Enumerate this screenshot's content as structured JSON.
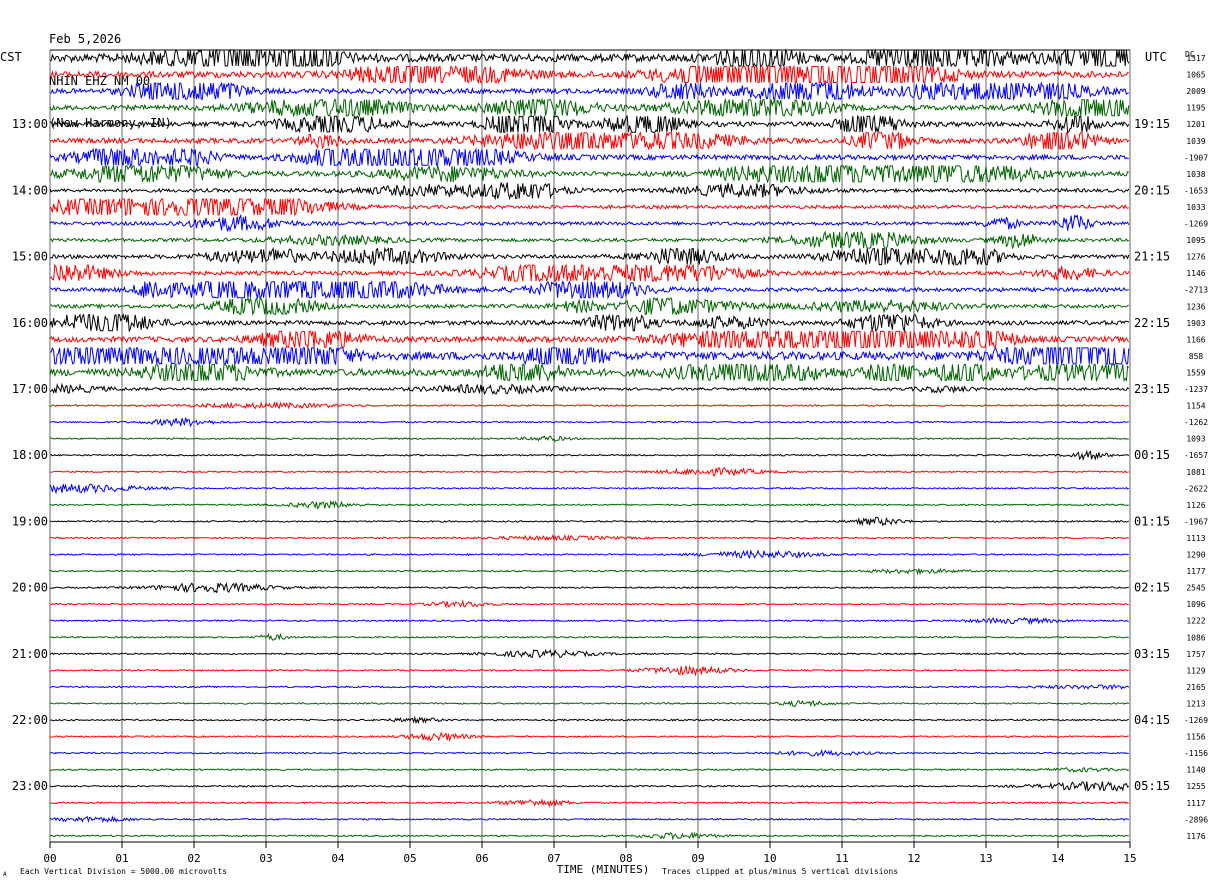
{
  "header": {
    "date": "Feb 5,2026",
    "station": "NHIN EHZ NM 00",
    "location": "(New Harmony, IN)"
  },
  "left_timezone": "CST",
  "right_timezone": "UTC",
  "dc_label": "DC",
  "footer": {
    "scale_note": "Each Vertical Division = 5000.00 microvolts",
    "clip_note": "Traces clipped at plus/minus 5 vertical divisions",
    "corner_mark": "A"
  },
  "colors": {
    "black": "#000000",
    "red": "#ff0000",
    "blue": "#0000ff",
    "green": "#006400",
    "grid": "#000000"
  },
  "chart_data": {
    "type": "line",
    "title": "NHIN EHZ NM 00",
    "xlabel": "TIME (MINUTES)",
    "ylabel": "",
    "x_ticks": [
      "00",
      "01",
      "02",
      "03",
      "04",
      "05",
      "06",
      "07",
      "08",
      "09",
      "10",
      "11",
      "12",
      "13",
      "14",
      "15"
    ],
    "xlim": [
      0,
      15
    ],
    "trace_color_cycle": [
      "black",
      "red",
      "blue",
      "green"
    ],
    "left_hour_labels": [
      "13:00",
      "14:00",
      "15:00",
      "16:00",
      "17:00",
      "18:00",
      "19:00",
      "20:00",
      "21:00",
      "22:00",
      "23:00"
    ],
    "right_hour_labels": [
      "19:15",
      "20:15",
      "21:15",
      "22:15",
      "23:15",
      "00:15",
      "01:15",
      "02:15",
      "03:15",
      "04:15",
      "05:15"
    ],
    "dc_offsets": [
      "1317",
      "1065",
      "2009",
      "1195",
      "1201",
      "1039",
      "-1907",
      "1038",
      "-1653",
      "1033",
      "-1269",
      "1095",
      "1276",
      "1146",
      "-2713",
      "1236",
      "1903",
      "1166",
      "858",
      "1559",
      "-1237",
      "1154",
      "-1262",
      "1093",
      "-1657",
      "1081",
      "-2622",
      "1126",
      "-1967",
      "1113",
      "1290",
      "1177",
      "2545",
      "1096",
      "1222",
      "1086",
      "1757",
      "1129",
      "2165",
      "1213",
      "-1269",
      "1156",
      "-1156",
      "1140",
      "1255",
      "1117",
      "-2896",
      "1176"
    ],
    "trace_activity": [
      3.2,
      2.6,
      2.0,
      2.0,
      2.0,
      2.0,
      2.0,
      2.0,
      1.4,
      1.4,
      1.4,
      1.4,
      1.6,
      1.6,
      1.6,
      1.6,
      1.8,
      2.2,
      3.4,
      2.8,
      1.0,
      0.6,
      0.6,
      0.6,
      0.6,
      0.6,
      0.6,
      0.6,
      0.6,
      0.6,
      0.6,
      0.6,
      0.6,
      0.6,
      0.6,
      0.6,
      0.6,
      0.6,
      0.6,
      0.6,
      0.6,
      0.6,
      0.6,
      0.6,
      0.6,
      0.6,
      0.6,
      0.6
    ]
  }
}
